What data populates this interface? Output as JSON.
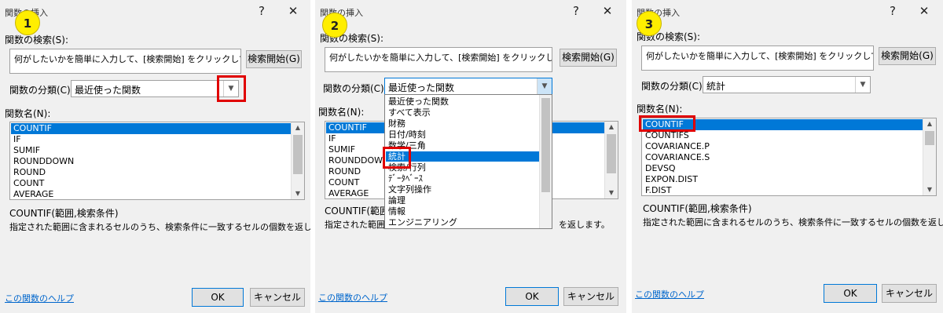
{
  "steps": [
    "1",
    "2",
    "3"
  ],
  "dialog": {
    "title": "関数の挿入",
    "help_button": "?",
    "close_button": "✕",
    "search_label": "関数の検索(S):",
    "search_value": "何がしたいかを簡単に入力して、[検索開始] をクリックしてください。",
    "search_button": "検索開始(G)",
    "category_label": "関数の分類(C):",
    "function_name_label": "関数名(N):",
    "help_link": "この関数のヘルプ",
    "ok_button": "OK",
    "cancel_button": "キャンセル"
  },
  "panel1": {
    "category_value": "最近使った関数",
    "functions": [
      "COUNTIF",
      "IF",
      "SUMIF",
      "ROUNDDOWN",
      "ROUND",
      "COUNT",
      "AVERAGE"
    ],
    "selected_index": 0,
    "syntax": "COUNTIF(範囲,検索条件)",
    "description": "指定された範囲に含まれるセルのうち、検索条件に一致するセルの個数を返します。"
  },
  "panel2": {
    "category_value": "最近使った関数",
    "functions": [
      "COUNTIF",
      "IF",
      "SUMIF",
      "ROUNDDOW",
      "ROUND",
      "COUNT",
      "AVERAGE"
    ],
    "syntax": "COUNTIF(範囲",
    "description_start": "指定された範囲",
    "description_end": "を返します。",
    "dropdown_options": [
      "最近使った関数",
      "すべて表示",
      "財務",
      "日付/時刻",
      "数学/三角",
      "統計",
      "検索/行列",
      "ﾃﾞｰﾀﾍﾞｰｽ",
      "文字列操作",
      "論理",
      "情報",
      "エンジニアリング"
    ],
    "dropdown_selected_index": 5
  },
  "panel3": {
    "category_value": "統計",
    "functions": [
      "COUNTIF",
      "COUNTIFS",
      "COVARIANCE.P",
      "COVARIANCE.S",
      "DEVSQ",
      "EXPON.DIST",
      "F.DIST"
    ],
    "selected_index": 0,
    "syntax": "COUNTIF(範囲,検索条件)",
    "description": "指定された範囲に含まれるセルのうち、検索条件に一致するセルの個数を返します。"
  },
  "colors": {
    "selection": "#0078d7",
    "highlight": "#e00000",
    "badge": "#ffee00",
    "link": "#0066cc"
  }
}
